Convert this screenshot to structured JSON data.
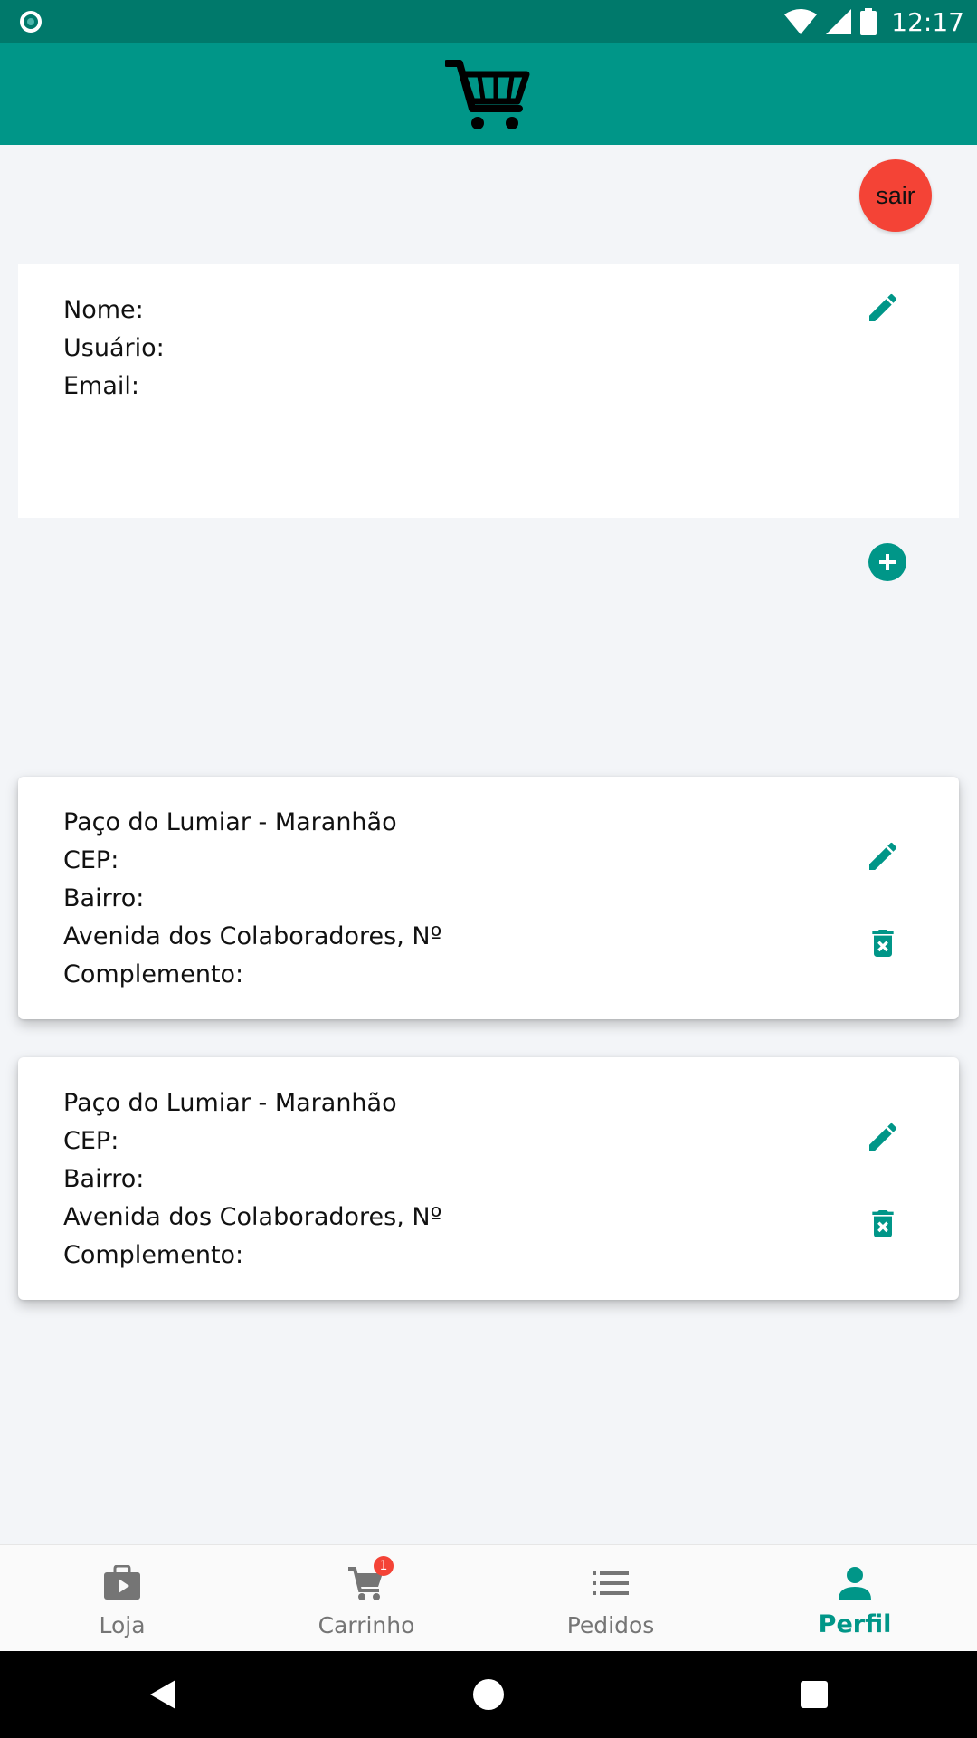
{
  "status_bar": {
    "time": "12:17"
  },
  "logout": {
    "label": "sair"
  },
  "profile": {
    "name_label": "Nome:",
    "user_label": "Usuário:",
    "email_label": "Email:"
  },
  "addresses": [
    {
      "city": "Paço do Lumiar - Maranhão",
      "cep_label": "CEP:",
      "bairro_label": "Bairro:",
      "street": "Avenida dos Colaboradores, Nº",
      "complement_label": "Complemento:"
    },
    {
      "city": "Paço do Lumiar - Maranhão",
      "cep_label": "CEP:",
      "bairro_label": "Bairro:",
      "street": "Avenida dos Colaboradores, Nº",
      "complement_label": "Complemento:"
    }
  ],
  "bottom_nav": {
    "items": [
      {
        "label": "Loja",
        "icon": "store-icon"
      },
      {
        "label": "Carrinho",
        "icon": "cart-icon",
        "badge": "1"
      },
      {
        "label": "Pedidos",
        "icon": "list-icon"
      },
      {
        "label": "Perfil",
        "icon": "person-icon",
        "active": true
      }
    ]
  },
  "colors": {
    "primary": "#009688",
    "primary_dark": "#00796b",
    "danger": "#f44336",
    "background": "#f3f5f8"
  }
}
